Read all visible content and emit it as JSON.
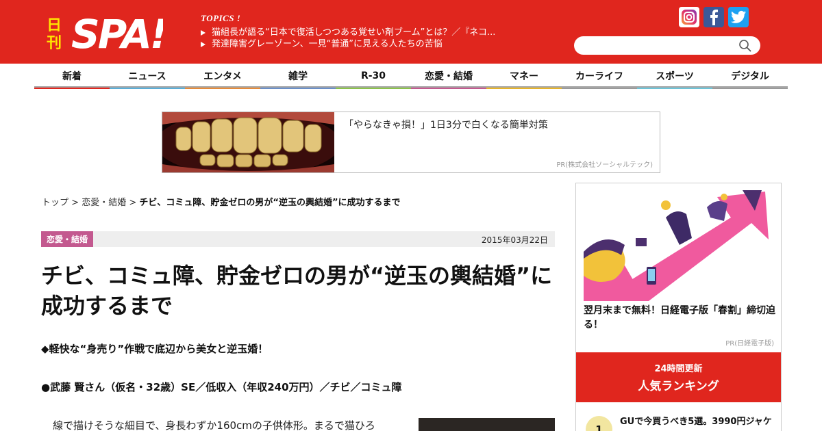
{
  "header": {
    "logo_text": "日刊SPA!",
    "topics_title": "TOPICS !",
    "topics": [
      "猫組長が語る“日本で復活しつつある覚せい剤ブーム”とは？／『ネコ...",
      "発達障害グレーゾーン、一見“普通”に見える人たちの苦悩"
    ],
    "social_icons": [
      "instagram-icon",
      "facebook-icon",
      "twitter-icon"
    ],
    "search_placeholder": ""
  },
  "nav": {
    "items": [
      {
        "label": "新着",
        "color": "#e0261e"
      },
      {
        "label": "ニュース",
        "color": "#5aaed8"
      },
      {
        "label": "エンタメ",
        "color": "#e58b3a"
      },
      {
        "label": "雑学",
        "color": "#6a8fc8"
      },
      {
        "label": "R-30",
        "color": "#8bc34a"
      },
      {
        "label": "恋愛・結婚",
        "color": "#c3598f"
      },
      {
        "label": "マネー",
        "color": "#e7b42a"
      },
      {
        "label": "カーライフ",
        "color": "#9a9a9a"
      },
      {
        "label": "スポーツ",
        "color": "#6cc4d8"
      },
      {
        "label": "デジタル",
        "color": "#9a9a9a"
      }
    ]
  },
  "ad": {
    "text": "「やらなきゃ損！」1日3分で白くなる簡単対策",
    "pr": "PR(株式会社ソーシャルテック)"
  },
  "breadcrumb": {
    "top": "トップ",
    "sep": ">",
    "category": "恋愛・結婚",
    "current": "チビ、コミュ障、貯金ゼロの男が“逆玉の輿結婚”に成功するまで"
  },
  "article": {
    "category": "恋愛・結婚",
    "date": "2015年03月22日",
    "title": "チビ、コミュ障、貯金ゼロの男が“逆玉の輿結婚”に成功するまで",
    "lead": "◆軽快な“身売り”作戦で底辺から美女と逆玉婚！",
    "subhead": "●武藤 賢さん（仮名・32歳）SE／低収入（年収240万円）／チビ／コミュ障",
    "body": "線で描けそうな細目で、身長わずか160cmの子供体形。まるで猫ひろ"
  },
  "sidebar": {
    "ad_text": "翌月末まで無料！日経電子版「春割」締切迫る！",
    "ad_pr": "PR(日経電子版)",
    "ranking_label_1": "24時間更新",
    "ranking_label_2": "人気ランキング",
    "ranking_items": [
      {
        "rank": "1",
        "text": "GUで今買うべき5選。3990円ジャケ"
      }
    ]
  },
  "colors": {
    "brand_red": "#e0261e",
    "category_pink": "#c3598f"
  }
}
